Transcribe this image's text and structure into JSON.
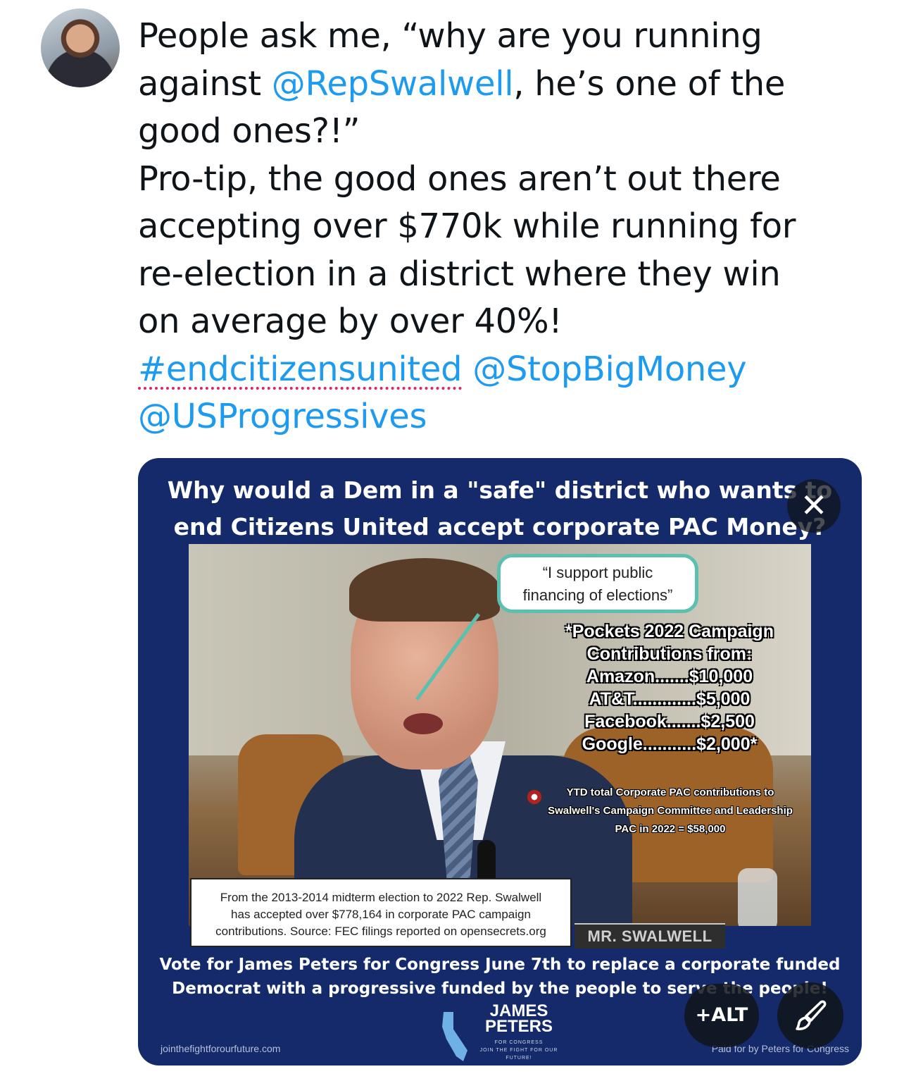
{
  "tweet": {
    "text_line1": "People ask me, “why are you running",
    "text_line2_pre": "against ",
    "mention_swalwell": "@RepSwalwell",
    "text_line2_post": ", he’s one of the",
    "text_line3": "good ones?!”",
    "text_line4": "Pro-tip, the good ones aren’t out there",
    "text_line5": "accepting over $770k while running for",
    "text_line6": "re-election in a district where they win",
    "text_line7": "on average by over 40%!",
    "hashtag": "#endcitizensunited",
    "mention_stopbigmoney": "@StopBigMoney",
    "mention_usprogressives": "@USProgressives"
  },
  "media": {
    "title_line1": "Why would a Dem in a \"safe\" district who wants to",
    "title_line2": "end Citizens United accept corporate PAC Money?",
    "bubble_line1": "“I support public",
    "bubble_line2": "financing of elections”",
    "pockets": [
      "*Pockets 2022 Campaign",
      "Contributions from:",
      "Amazon.......$10,000",
      "AT&T.............$5,000",
      "Facebook.......$2,500",
      "Google...........$2,000*"
    ],
    "ytd_line1": "YTD total Corporate PAC contributions to",
    "ytd_line2": "Swalwell's Campaign Committee and Leadership",
    "ytd_line3": "PAC in 2022 = $58,000",
    "source_line1": "From the 2013-2014 midterm election to 2022 Rep. Swalwell",
    "source_line2": "has accepted over $778,164 in corporate PAC campaign",
    "source_line3": "contributions. Source: FEC filings reported on opensecrets.org",
    "nameplate": "MR. SWALWELL",
    "vote_line1": "Vote for James Peters for Congress June 7th to replace a corporate funded",
    "vote_line2": "Democrat with a progressive funded by the people to serve the people!",
    "logo_name_line1": "JAMES",
    "logo_name_line2": "PETERS",
    "logo_sub_line1": "FOR CONGRESS",
    "logo_sub_line2": "JOIN THE FIGHT FOR OUR FUTURE!",
    "footer_left": "jointhefightforourfuture.com",
    "footer_right": "Paid for by Peters for Congress"
  },
  "controls": {
    "close_glyph": "✕",
    "alt_label": "+ALT",
    "close_icon": "close-icon",
    "edit_icon": "paintbrush-icon"
  },
  "colors": {
    "link": "#1d9bf0",
    "media_bg": "#142a6b",
    "bubble_border": "#5cc0b0"
  }
}
